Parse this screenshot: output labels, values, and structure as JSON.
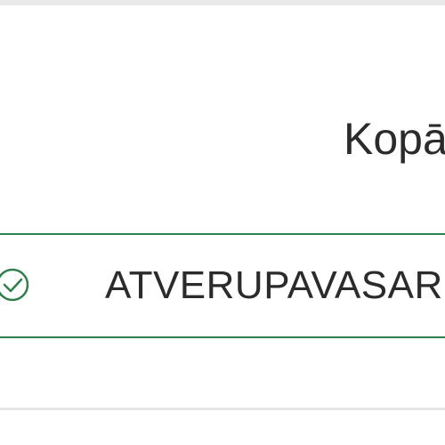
{
  "summary": {
    "total_label": "Kopā"
  },
  "promo": {
    "code": "ATVERUPAVASAR",
    "status_icon": "check-circle-icon",
    "accent_color": "#2f7f4d"
  }
}
